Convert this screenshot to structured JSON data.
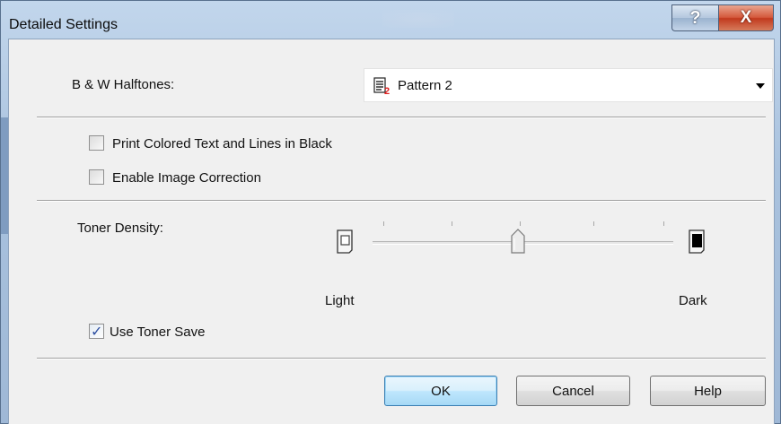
{
  "window": {
    "title": "Detailed Settings",
    "help_glyph": "?",
    "close_glyph": "X"
  },
  "halftones": {
    "label": "B & W Halftones:",
    "selected": "Pattern 2",
    "icon": "pattern-2-icon"
  },
  "options": {
    "print_black": {
      "label": "Print Colored Text and Lines in Black",
      "checked": false
    },
    "image_correction": {
      "label": "Enable Image Correction",
      "checked": false
    },
    "toner_save": {
      "label": "Use Toner Save",
      "checked": true,
      "tick": "✓"
    }
  },
  "toner": {
    "label": "Toner Density:",
    "min_label": "Light",
    "max_label": "Dark",
    "value_fraction": 0.5,
    "light_icon": "light-page-icon",
    "dark_icon": "dark-page-icon"
  },
  "buttons": {
    "ok": "OK",
    "cancel": "Cancel",
    "help": "Help"
  },
  "colors": {
    "default_button_border": "#3c7fb1",
    "close_button": "#c1391d",
    "check_tick": "#2d4fa1"
  }
}
